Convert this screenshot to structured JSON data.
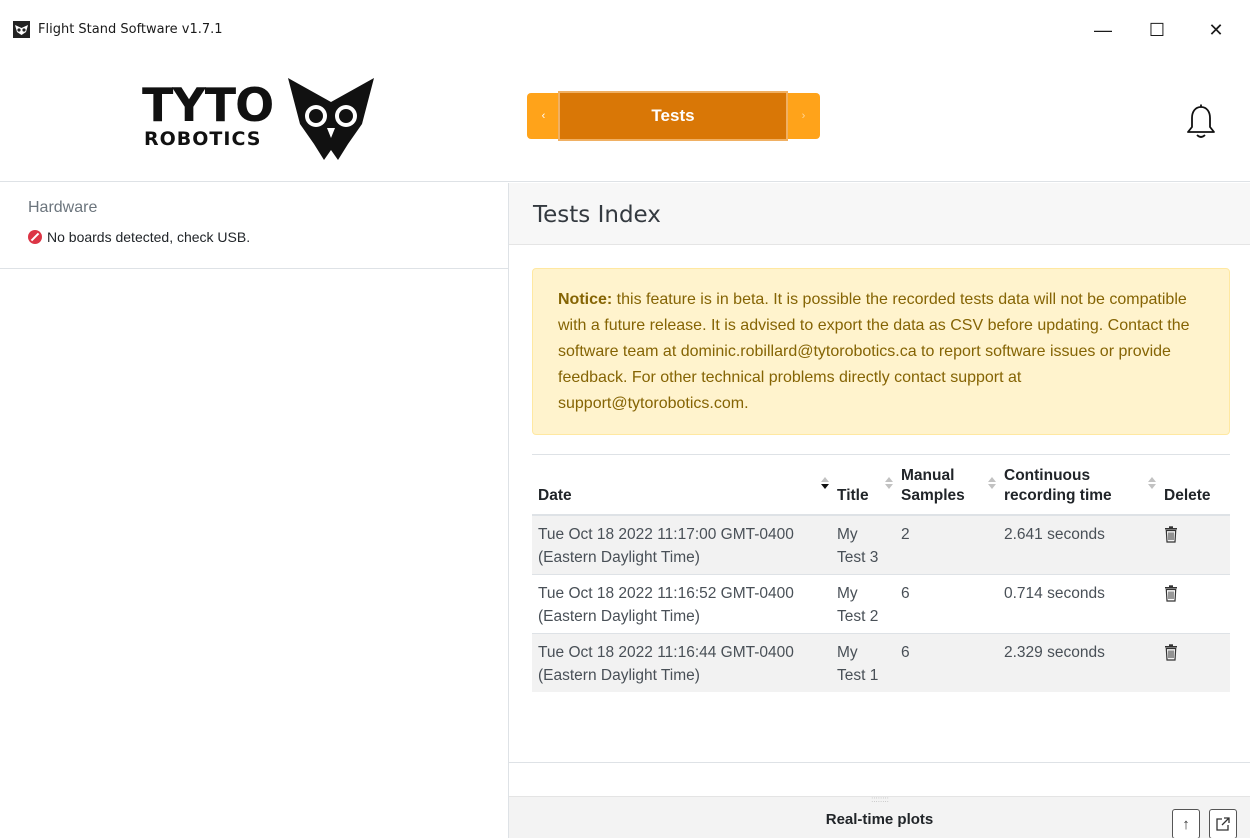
{
  "window": {
    "title": "Flight Stand Software v1.7.1",
    "min_symbol": "—",
    "max_symbol": "☐",
    "close_symbol": "✕"
  },
  "header": {
    "logo_text_top": "TYTO",
    "logo_text_bottom": "ROBOTICS",
    "nav": {
      "prev_symbol": "‹",
      "next_symbol": "›",
      "active_tab": "Tests"
    },
    "bell_icon": "bell-icon"
  },
  "sidebar": {
    "hardware_title": "Hardware",
    "hardware_status": "No boards detected, check USB.",
    "status_color": "#dc3545"
  },
  "main": {
    "title": "Tests Index",
    "notice_bold": "Notice:",
    "notice_text": " this feature is in beta. It is possible the recorded tests data will not be compatible with a future release. It is advised to export the data as CSV before updating. Contact the software team at dominic.robillard@tytorobotics.ca to report software issues or provide feedback. For other technical problems directly contact support at support@tytorobotics.com.",
    "table": {
      "headers": {
        "date": "Date",
        "title": "Title",
        "samples": "Manual Samples",
        "recording": "Continuous recording time",
        "delete": "Delete"
      },
      "rows": [
        {
          "date": "Tue Oct 18 2022 11:17:00 GMT-0400 (Eastern Daylight Time)",
          "title": "My Test 3",
          "samples": "2",
          "recording": "2.641 seconds"
        },
        {
          "date": "Tue Oct 18 2022 11:16:52 GMT-0400 (Eastern Daylight Time)",
          "title": "My Test 2",
          "samples": "6",
          "recording": "0.714 seconds"
        },
        {
          "date": "Tue Oct 18 2022 11:16:44 GMT-0400 (Eastern Daylight Time)",
          "title": "My Test 1",
          "samples": "6",
          "recording": "2.329 seconds"
        }
      ]
    }
  },
  "plots": {
    "label": "Real-time plots",
    "grip": "::::::::",
    "up_symbol": "↑",
    "popout_icon": "popout-icon"
  },
  "colors": {
    "accent": "#d97706",
    "accent_light": "#ffa31a",
    "notice_bg": "#fff3cd",
    "notice_text": "#856404"
  }
}
